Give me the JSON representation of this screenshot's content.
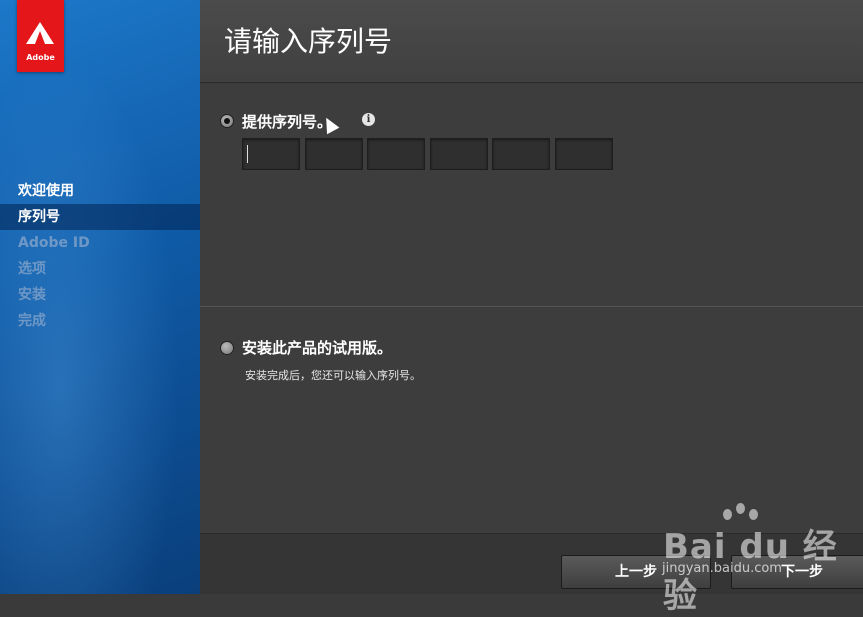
{
  "sidebar": {
    "logo_text": "Adobe",
    "steps": [
      {
        "label": "欢迎使用",
        "state": "done"
      },
      {
        "label": "序列号",
        "state": "active"
      },
      {
        "label": "Adobe ID",
        "state": "pending"
      },
      {
        "label": "选项",
        "state": "pending"
      },
      {
        "label": "安装",
        "state": "pending"
      },
      {
        "label": "完成",
        "state": "pending"
      }
    ]
  },
  "main": {
    "title": "请输入序列号",
    "option_serial": {
      "label": "提供序列号。",
      "selected": true,
      "info_icon": "i",
      "serial_fields": [
        "",
        "",
        "",
        "",
        "",
        ""
      ]
    },
    "option_trial": {
      "label": "安装此产品的试用版。",
      "selected": false,
      "sublabel": "安装完成后，您还可以输入序列号。"
    }
  },
  "footer": {
    "back_label": "上一步",
    "next_label": "下一步"
  },
  "watermark": {
    "brand": "Bai du 经验",
    "url": "jingyan.baidu.com"
  },
  "colors": {
    "sidebar_blue": "#0f5aa6",
    "logo_red": "#e4161a",
    "panel_gray": "#3d3d3d"
  }
}
